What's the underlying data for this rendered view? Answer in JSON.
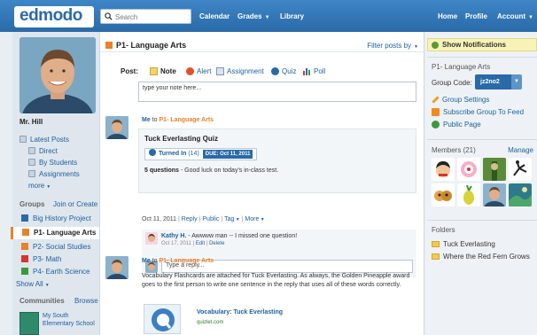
{
  "app": {
    "logo": "edmodo"
  },
  "search": {
    "placeholder": "Search"
  },
  "nav": {
    "calendar": "Calendar",
    "grades": "Grades",
    "library": "Library",
    "home": "Home",
    "profile": "Profile",
    "account": "Account"
  },
  "sidebar": {
    "name": "Mr. Hill",
    "latest_posts": "Latest Posts",
    "direct": "Direct",
    "by_students": "By Students",
    "assignments": "Assignments",
    "more": "more",
    "groups_label": "Groups",
    "join_or_create": "Join or Create",
    "groups": [
      {
        "label": "Big History Project",
        "color": "#2a6aa8"
      },
      {
        "label": "P1- Language Arts",
        "color": "#e8822b"
      },
      {
        "label": "P2- Social Studies",
        "color": "#e8822b"
      },
      {
        "label": "P3- Math",
        "color": "#d9342b"
      },
      {
        "label": "P4- Earth Science",
        "color": "#3a9a3a"
      }
    ],
    "show_all": "Show All",
    "communities_label": "Communities",
    "browse": "Browse",
    "community": "My South Elementary School"
  },
  "main": {
    "group_title": "P1- Language Arts",
    "filter": "Filter posts by",
    "post_label": "Post:",
    "post_types": [
      "Note",
      "Alert",
      "Assignment",
      "Quiz",
      "Poll"
    ],
    "note_placeholder": "type your note here...",
    "posts": [
      {
        "author": "Me",
        "to": "to",
        "group": "P1- Language Arts",
        "title": "Tuck Everlasting Quiz",
        "turned_in": "Turned In",
        "turned_in_count": "(14)",
        "due": "DUE: Oct 11, 2011",
        "questions": "5 questions",
        "description": " - Good luck on today's in-class test.",
        "date": "Oct 11, 2011",
        "actions": [
          "Reply",
          "Public",
          "Tag",
          "More"
        ],
        "reply_author": "Kathy H.",
        "reply_text": " - Awwww man -- I missed one question!",
        "reply_date": "Oct 17, 2011",
        "reply_edit": "Edit",
        "reply_delete": "Delete",
        "reply_placeholder": "Type a reply..."
      },
      {
        "author": "Me",
        "to": "to",
        "group": "P1- Language Arts",
        "text": "Vocabulary Flashcards are attached for Tuck Everlasting. As always, the Golden Pineapple award goes to the first person to write one sentence in the reply that uses all of these words correctly.",
        "attachment_title": "Vocabulary: Tuck Everlasting",
        "attachment_url": "quizlet.com"
      }
    ]
  },
  "right": {
    "show_notifications": "Show Notifications",
    "group_title": "P1- Language Arts",
    "group_code_label": "Group Code:",
    "group_code": "jz2no2",
    "group_settings": "Group Settings",
    "subscribe": "Subscribe Group To Feed",
    "public_page": "Public Page",
    "members": "Members (21)",
    "manage": "Manage",
    "folders_label": "Folders",
    "folders": [
      "Tuck Everlasting",
      "Where the Red Fern Grows"
    ]
  },
  "colors": {
    "brand": "#2a6aa8",
    "accent": "#e8822b",
    "link": "#1e5f9b"
  }
}
